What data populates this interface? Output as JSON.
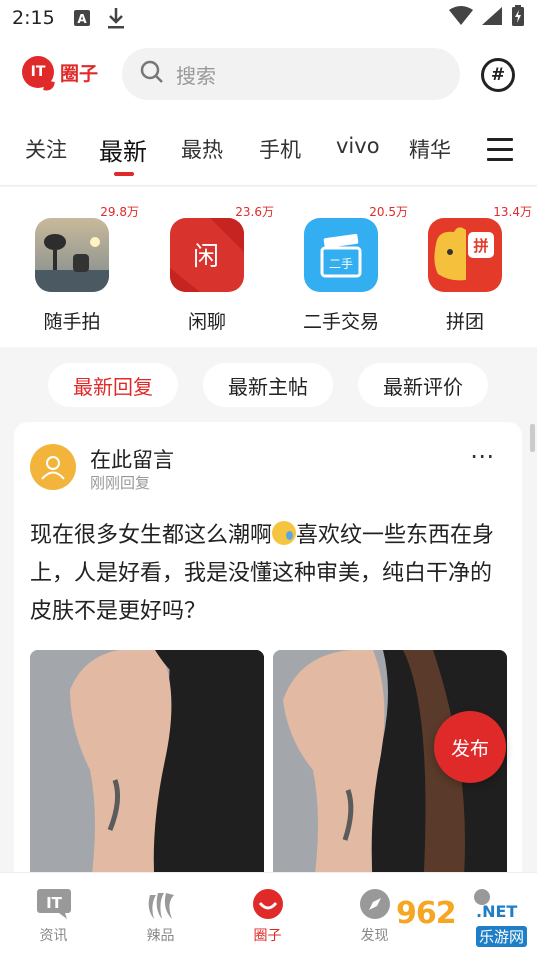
{
  "status_bar": {
    "time": "2:15"
  },
  "header": {
    "logo_text": "圈子",
    "search_placeholder": "搜索"
  },
  "tabs": [
    "关注",
    "最新",
    "最热",
    "手机",
    "vivo",
    "精华"
  ],
  "active_tab": "最新",
  "circles": [
    {
      "name": "随手拍",
      "count": "29.8万"
    },
    {
      "name": "闲聊",
      "count": "23.6万",
      "icon_text": "闲"
    },
    {
      "name": "二手交易",
      "count": "20.5万",
      "icon_text": "二手"
    },
    {
      "name": "拼团",
      "count": "13.4万",
      "icon_text": "拼"
    }
  ],
  "filters": [
    "最新回复",
    "最新主帖",
    "最新评价"
  ],
  "post": {
    "author": "在此留言",
    "time": "刚刚回复",
    "text_before_emoji": "现在很多女生都这么潮啊",
    "text_after_emoji": "喜欢纹一些东西在身上，人是好看，我是没懂这种审美，纯白干净的皮肤不是更好吗？"
  },
  "fab_label": "发布",
  "bottom_nav": [
    {
      "label": "资讯",
      "icon": "IT"
    },
    {
      "label": "辣品"
    },
    {
      "label": "圈子"
    },
    {
      "label": "发现"
    },
    {
      "label": ""
    }
  ],
  "watermark": {
    "number": "962",
    "net": ".NET",
    "sub": "乐游网"
  },
  "colors": {
    "accent": "#e02a2a",
    "avatar": "#f2b43b",
    "watermark_orange": "#f5a623",
    "watermark_blue": "#1e7fc6"
  }
}
